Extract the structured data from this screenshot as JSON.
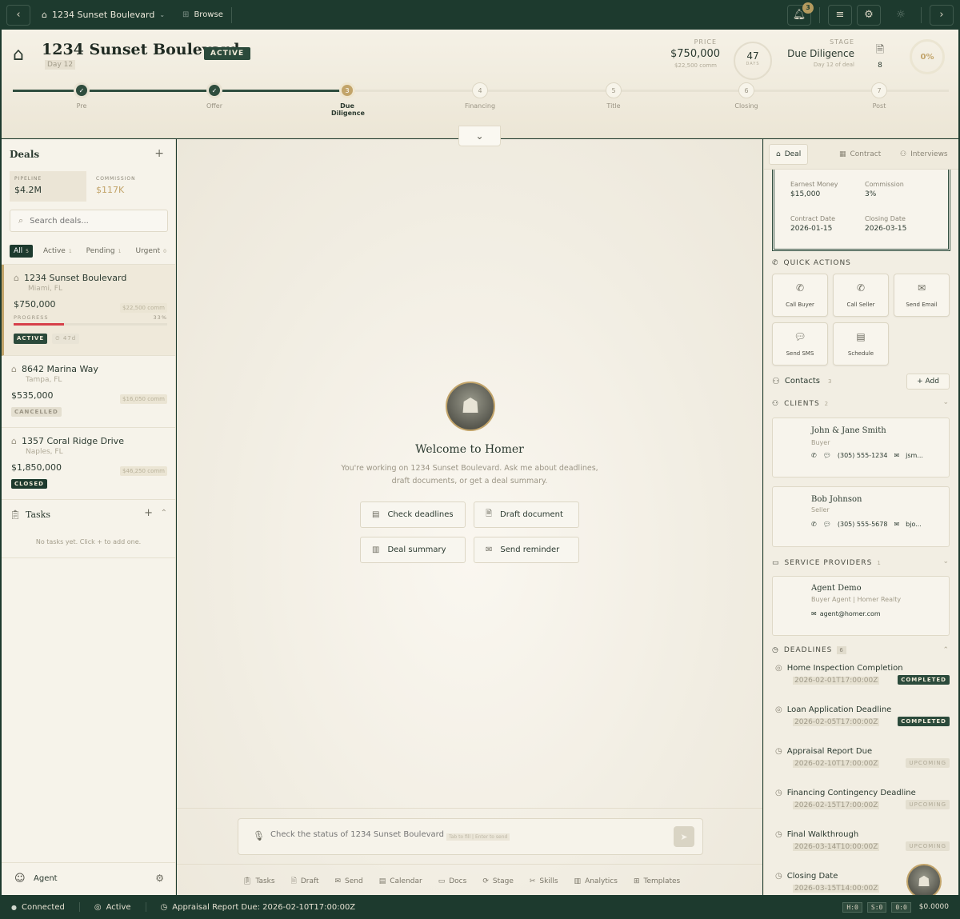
{
  "topbar": {
    "address": "1234 Sunset Boulevard",
    "browse": "Browse",
    "notifications": "3",
    "back": "‹",
    "forward": "›"
  },
  "header": {
    "title": "1234 Sunset Boulevard",
    "day": "Day 12",
    "status": "ACTIVE",
    "price_label": "PRICE",
    "price": "$750,000",
    "price_sub": "$22,500 comm",
    "days_value": "47",
    "days_label": "DAYS",
    "stage_label": "STAGE",
    "stage": "Due Diligence",
    "stage_sub": "Day 12 of deal",
    "docs_count": "8",
    "progress": "0%"
  },
  "steps": [
    {
      "n": "✓",
      "label": "Pre",
      "state": "done"
    },
    {
      "n": "✓",
      "label": "Offer",
      "state": "done"
    },
    {
      "n": "3",
      "label": "Due Diligence",
      "state": "cur"
    },
    {
      "n": "4",
      "label": "Financing",
      "state": "next"
    },
    {
      "n": "5",
      "label": "Title",
      "state": "next"
    },
    {
      "n": "6",
      "label": "Closing",
      "state": "next"
    },
    {
      "n": "7",
      "label": "Post",
      "state": "next"
    }
  ],
  "left": {
    "title": "Deals",
    "pipeline_label": "PIPELINE",
    "pipeline": "$4.2M",
    "commission_label": "COMMISSION",
    "commission": "$117K",
    "search_placeholder": "Search deals...",
    "filters": [
      {
        "label": "All",
        "count": "5"
      },
      {
        "label": "Active",
        "count": "1"
      },
      {
        "label": "Pending",
        "count": "1"
      },
      {
        "label": "Urgent",
        "count": "0"
      }
    ],
    "deals": [
      {
        "name": "1234 Sunset Boulevard",
        "city": "Miami, FL",
        "price": "$750,000",
        "comm": "$22,500 comm",
        "progress_label": "PROGRESS",
        "progress_pct": "33%",
        "progress": 0.33,
        "status": "ACTIVE",
        "days": "⏲ 47d"
      },
      {
        "name": "8642 Marina Way",
        "city": "Tampa, FL",
        "price": "$535,000",
        "comm": "$16,050 comm",
        "status": "CANCELLED"
      },
      {
        "name": "1357 Coral Ridge Drive",
        "city": "Naples, FL",
        "price": "$1,850,000",
        "comm": "$46,250 comm",
        "status": "CLOSED"
      }
    ],
    "tasks_title": "Tasks",
    "tasks_empty": "No tasks yet. Click + to add one.",
    "user": "Agent"
  },
  "center": {
    "welcome": "Welcome to Homer",
    "subtitle1": "You're working on 1234 Sunset Boulevard. Ask me about deadlines,",
    "subtitle2": "draft documents, or get a deal summary.",
    "suggestions": [
      "Check deadlines",
      "Draft document",
      "Deal summary",
      "Send reminder"
    ],
    "input_placeholder": "Check the status of 1234 Sunset Boulevard",
    "input_hint": "Tab to fill | Enter to send",
    "tools": [
      "Tasks",
      "Draft",
      "Send",
      "Calendar",
      "Docs",
      "Stage",
      "Skills",
      "Analytics",
      "Templates"
    ]
  },
  "right": {
    "tabs": [
      "Deal",
      "Contract",
      "Interviews"
    ],
    "earnest_label": "Earnest Money",
    "earnest": "$15,000",
    "comm_label": "Commission",
    "comm": "3%",
    "contract_date_label": "Contract Date",
    "contract_date": "2026-01-15",
    "closing_label": "Closing Date",
    "closing": "2026-03-15",
    "quick_title": "QUICK ACTIONS",
    "actions": [
      "Call Buyer",
      "Call Seller",
      "Send Email",
      "Send SMS",
      "Schedule"
    ],
    "contacts_title": "Contacts",
    "contacts_count": "3",
    "add": "+ Add",
    "clients_title": "CLIENTS",
    "clients_count": "2",
    "clients": [
      {
        "name": "John & Jane Smith",
        "role": "Buyer",
        "phone": "(305) 555-1234",
        "email": "jsm..."
      },
      {
        "name": "Bob Johnson",
        "role": "Seller",
        "phone": "(305) 555-5678",
        "email": "bjo..."
      }
    ],
    "providers_title": "SERVICE PROVIDERS",
    "providers_count": "1",
    "provider": {
      "name": "Agent Demo",
      "role": "Buyer Agent | Homer Realty",
      "email": "agent@homer.com"
    },
    "deadlines_title": "DEADLINES",
    "deadlines_count": "6",
    "deadlines": [
      {
        "name": "Home Inspection Completion",
        "date": "2026-02-01T17:00:00Z",
        "status": "COMPLETED"
      },
      {
        "name": "Loan Application Deadline",
        "date": "2026-02-05T17:00:00Z",
        "status": "COMPLETED"
      },
      {
        "name": "Appraisal Report Due",
        "date": "2026-02-10T17:00:00Z",
        "status": "UPCOMING"
      },
      {
        "name": "Financing Contingency Deadline",
        "date": "2026-02-15T17:00:00Z",
        "status": "UPCOMING"
      },
      {
        "name": "Final Walkthrough",
        "date": "2026-03-14T10:00:00Z",
        "status": "UPCOMING"
      },
      {
        "name": "Closing Date",
        "date": "2026-03-15T14:00:00Z",
        "status": ""
      }
    ]
  },
  "status": {
    "connected": "Connected",
    "active": "Active",
    "reminder": "Appraisal Report Due: 2026-02-10T17:00:00Z",
    "k1": "H:0",
    "k2": "S:0",
    "k3": "0:0",
    "money": "$0.0000"
  },
  "colors": {
    "primary": "#1d3a2e",
    "accent": "#c2a46a",
    "progress": "#d6404a"
  }
}
